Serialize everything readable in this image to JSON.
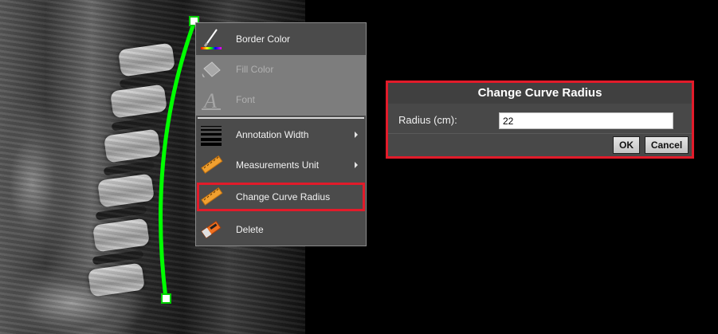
{
  "viewer": {
    "image": "spine-mri-sagittal",
    "annotation": {
      "type": "curve",
      "color": "#00ff00",
      "handle_color": "#ffffff"
    }
  },
  "context_menu": {
    "items": [
      {
        "label": "Border Color",
        "icon": "brush-palette-icon",
        "enabled": true
      },
      {
        "label": "Fill Color",
        "icon": "paint-bucket-icon",
        "enabled": false
      },
      {
        "label": "Font",
        "icon": "font-a-icon",
        "enabled": false
      },
      {
        "label": "Annotation Width",
        "icon": "line-width-icon",
        "enabled": true,
        "submenu": true
      },
      {
        "label": "Measurements Unit",
        "icon": "ruler-icon",
        "enabled": true,
        "submenu": true
      },
      {
        "label": "Change Curve Radius",
        "icon": "ruler-icon",
        "enabled": true,
        "highlighted": true
      },
      {
        "label": "Delete",
        "icon": "eraser-icon",
        "enabled": true
      }
    ]
  },
  "dialog": {
    "title": "Change Curve Radius",
    "radius_label": "Radius (cm):",
    "radius_value": "22",
    "ok_label": "OK",
    "cancel_label": "Cancel"
  },
  "colors": {
    "highlight": "#e21b2a",
    "menu_bg": "#4b4b4b",
    "disabled_bg": "#7d7d7d"
  }
}
